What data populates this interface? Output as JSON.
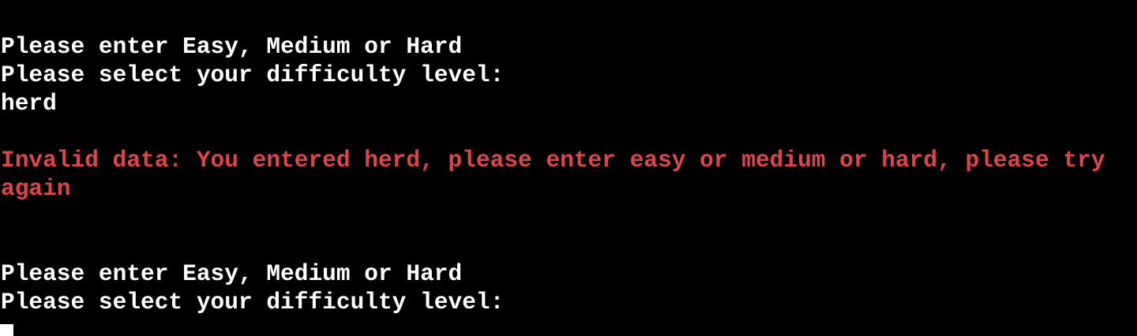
{
  "terminal": {
    "lines": [
      "Please enter Easy, Medium or Hard",
      "Please select your difficulty level:",
      "herd",
      "Invalid data: You entered herd, please enter easy or medium or hard, please try again",
      "Please enter Easy, Medium or Hard",
      "Please select your difficulty level:"
    ],
    "colors": {
      "background": "#000000",
      "text": "#ffffff",
      "error": "#e04646"
    }
  }
}
